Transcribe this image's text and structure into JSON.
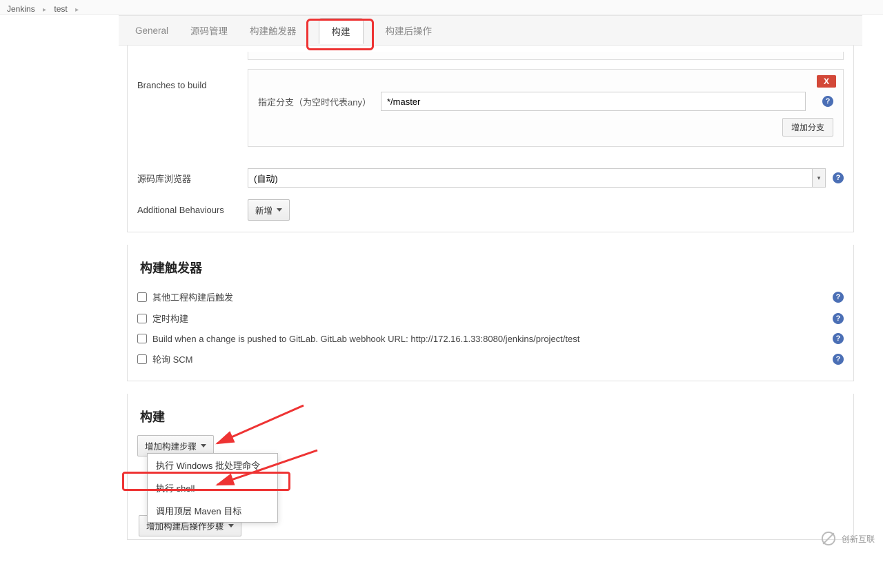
{
  "breadcrumb": {
    "root": "Jenkins",
    "item": "test"
  },
  "tabs": {
    "general": "General",
    "scm": "源码管理",
    "trigger": "构建触发器",
    "build": "构建",
    "post": "构建后操作"
  },
  "scm": {
    "branches_label": "Branches to build",
    "branch_field_label": "指定分支（为空时代表any）",
    "branch_value": "*/master",
    "add_branch": "增加分支",
    "delete_x": "X",
    "repo_browser_label": "源码库浏览器",
    "repo_browser_value": "(自动)",
    "add_behaviours_label": "Additional Behaviours",
    "add_behaviours_btn": "新增"
  },
  "triggers": {
    "title": "构建触发器",
    "after_other": "其他工程构建后触发",
    "timer": "定时构建",
    "gitlab": "Build when a change is pushed to GitLab. GitLab webhook URL: http://172.16.1.33:8080/jenkins/project/test",
    "poll_scm": "轮询 SCM"
  },
  "build": {
    "title": "构建",
    "add_step": "增加构建步骤",
    "menu": {
      "win": "执行 Windows 批处理命令",
      "shell": "执行 shell",
      "maven": "调用顶层 Maven 目标"
    },
    "add_post_step": "增加构建后操作步骤"
  },
  "watermark": "创新互联"
}
